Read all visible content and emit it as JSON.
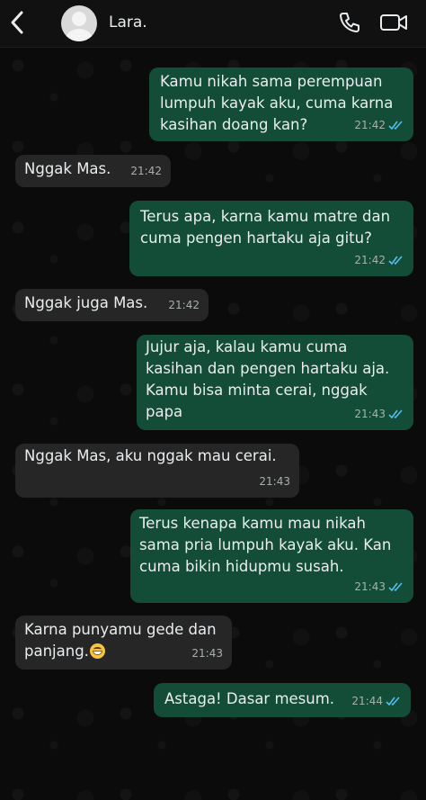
{
  "header": {
    "contact_name": "Lara.",
    "icons": [
      "chevron-left-icon",
      "avatar",
      "phone-icon",
      "video-icon"
    ]
  },
  "colors": {
    "incoming_bubble": "#262626",
    "outgoing_bubble": "#144d37",
    "read_tick": "#53bdeb"
  },
  "messages": [
    {
      "dir": "out",
      "text": "Kamu nikah sama perempuan\nlumpuh kayak aku, cuma karna\nkasihan doang kan?",
      "time": "21:42",
      "status": "read"
    },
    {
      "dir": "in",
      "text": "Nggak Mas.",
      "time": "21:42"
    },
    {
      "dir": "out",
      "text": "Terus apa, karna kamu matre dan\ncuma pengen hartaku aja gitu?",
      "time": "21:42",
      "status": "read"
    },
    {
      "dir": "in",
      "text": "Nggak juga Mas.",
      "time": "21:42"
    },
    {
      "dir": "out",
      "text": "Jujur aja, kalau kamu cuma\nkasihan dan pengen hartaku aja.\nKamu bisa minta cerai, nggak\npapa",
      "time": "21:43",
      "status": "read"
    },
    {
      "dir": "in",
      "text": "Nggak Mas, aku nggak mau cerai.",
      "time": "21:43"
    },
    {
      "dir": "out",
      "text": "Terus kenapa kamu mau nikah\nsama pria lumpuh kayak aku. Kan\ncuma bikin hidupmu susah.",
      "time": "21:43",
      "status": "read"
    },
    {
      "dir": "in",
      "text": "Karna punyamu gede dan\npanjang.",
      "time": "21:43",
      "emoji": "grinning-face-emoji"
    },
    {
      "dir": "out",
      "text": "Astaga! Dasar mesum.",
      "time": "21:44",
      "status": "read"
    }
  ]
}
